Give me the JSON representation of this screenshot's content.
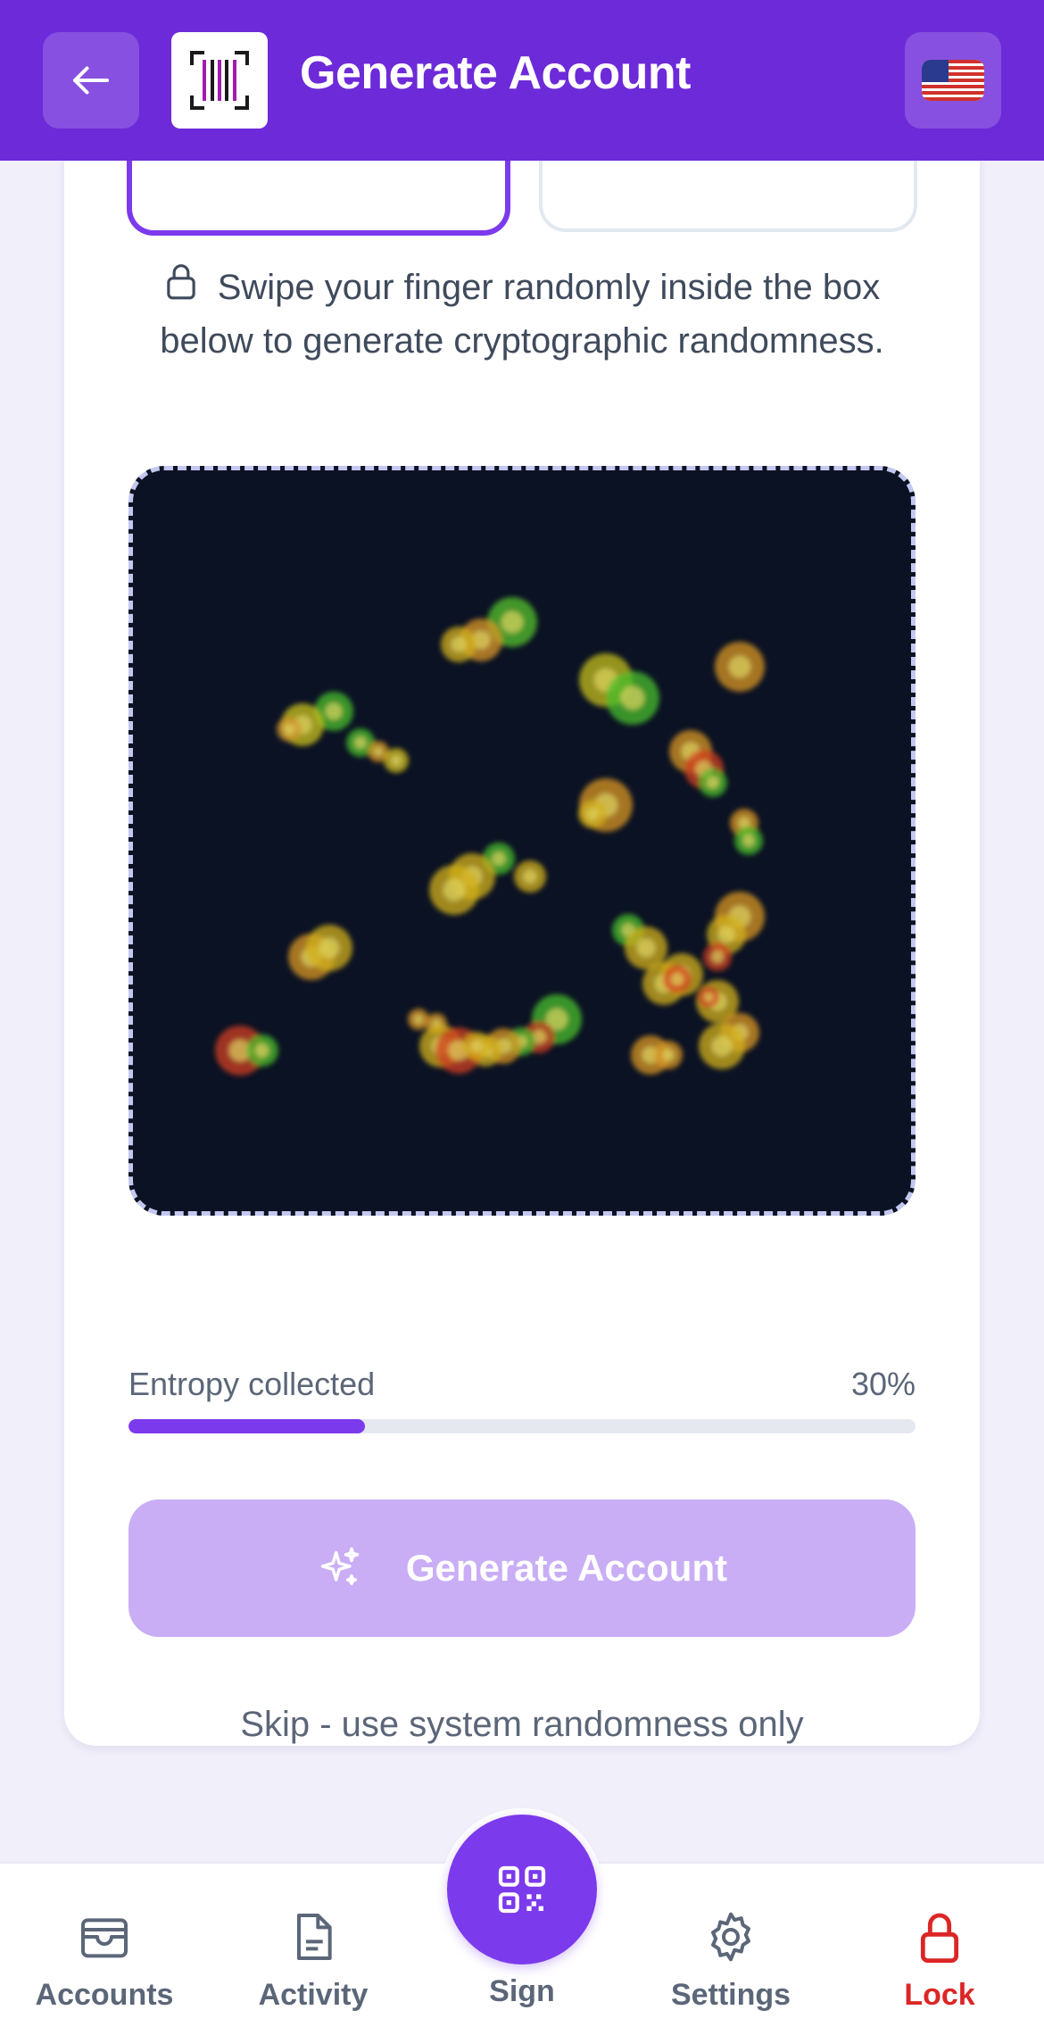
{
  "header": {
    "title": "Generate Account",
    "back_icon": "arrow-left-icon",
    "logo_icon": "barcode-logo-icon",
    "language_icon": "us-flag-icon"
  },
  "card": {
    "instructions": "Swipe your finger randomly inside the box below to generate cryptographic randomness.",
    "entropy_label": "Entropy collected",
    "entropy_percent_text": "30%",
    "entropy_fraction": 0.3,
    "generate_label": "Generate Account",
    "skip_label": "Skip - use system randomness only"
  },
  "nav": {
    "items": [
      {
        "label": "Accounts",
        "icon": "wallet-icon"
      },
      {
        "label": "Activity",
        "icon": "document-icon"
      },
      {
        "label": "Sign",
        "icon": "qr-code-icon"
      },
      {
        "label": "Settings",
        "icon": "gear-icon"
      },
      {
        "label": "Lock",
        "icon": "lock-icon"
      }
    ]
  },
  "colors": {
    "brand": "#6d2ad9",
    "accent": "#7c3aed",
    "generate_disabled": "#c9aef6",
    "entropy_bg": "#0b1224",
    "lock": "#dc2626"
  }
}
